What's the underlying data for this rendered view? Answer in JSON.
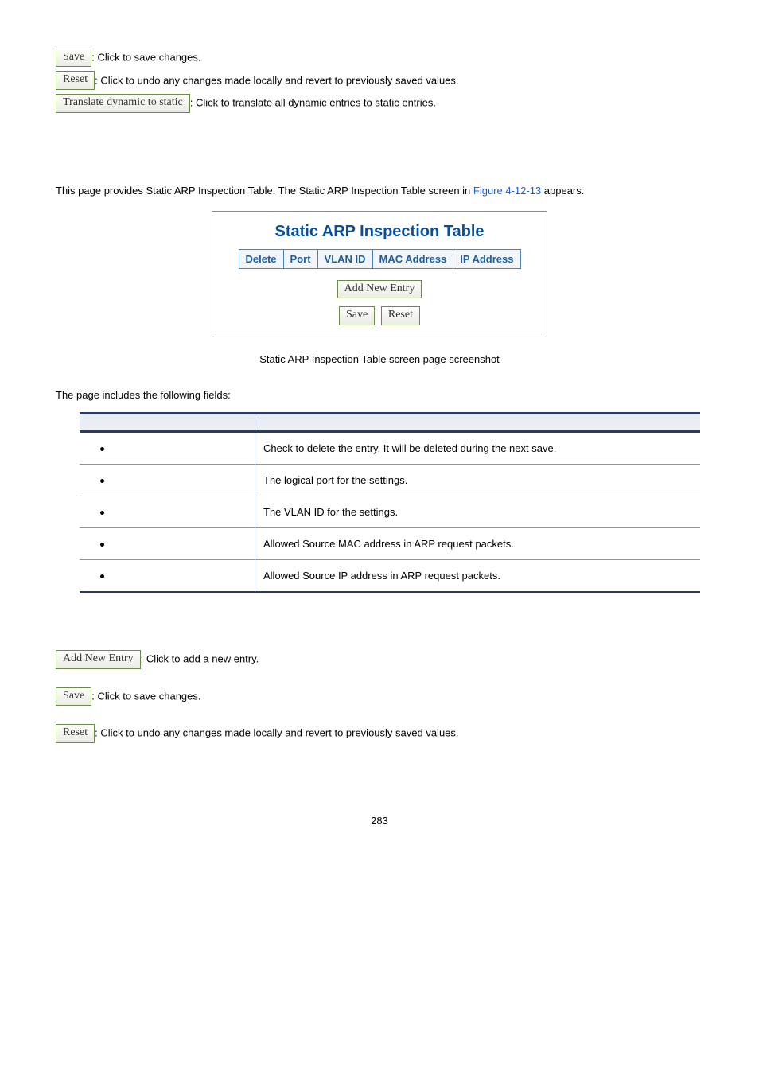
{
  "top_buttons": {
    "save": {
      "label": "Save",
      "desc": ": Click to save changes."
    },
    "reset": {
      "label": "Reset",
      "desc": ": Click to undo any changes made locally and revert to previously saved values."
    },
    "translate": {
      "label": "Translate dynamic to static",
      "desc": ": Click to translate all dynamic entries to static entries."
    }
  },
  "intro": {
    "pre": "This page provides Static ARP Inspection Table. The Static ARP Inspection Table screen in ",
    "figref": "Figure 4-12-13",
    "post": " appears."
  },
  "screenshot": {
    "title": "Static ARP Inspection Table",
    "headers": [
      "Delete",
      "Port",
      "VLAN ID",
      "MAC Address",
      "IP Address"
    ],
    "add_label": "Add New Entry",
    "save_label": "Save",
    "reset_label": "Reset"
  },
  "caption": "Static ARP Inspection Table screen page screenshot",
  "fields_intro": "The page includes the following fields:",
  "fields_table": {
    "col1_header": "",
    "col2_header": "",
    "rows": [
      {
        "label": "",
        "desc": "Check to delete the entry. It will be deleted during the next save."
      },
      {
        "label": "",
        "desc": "The logical port for the settings."
      },
      {
        "label": "",
        "desc": "The VLAN ID for the settings."
      },
      {
        "label": "",
        "desc": "Allowed Source MAC address in ARP request packets."
      },
      {
        "label": "",
        "desc": "Allowed Source IP address in ARP request packets."
      }
    ]
  },
  "bottom_buttons": {
    "add": {
      "label": "Add New Entry",
      "desc": ": Click to add a new entry."
    },
    "save": {
      "label": "Save",
      "desc": ": Click to save changes."
    },
    "reset": {
      "label": "Reset",
      "desc": ": Click to undo any changes made locally and revert to previously saved values."
    }
  },
  "page_number": "283"
}
